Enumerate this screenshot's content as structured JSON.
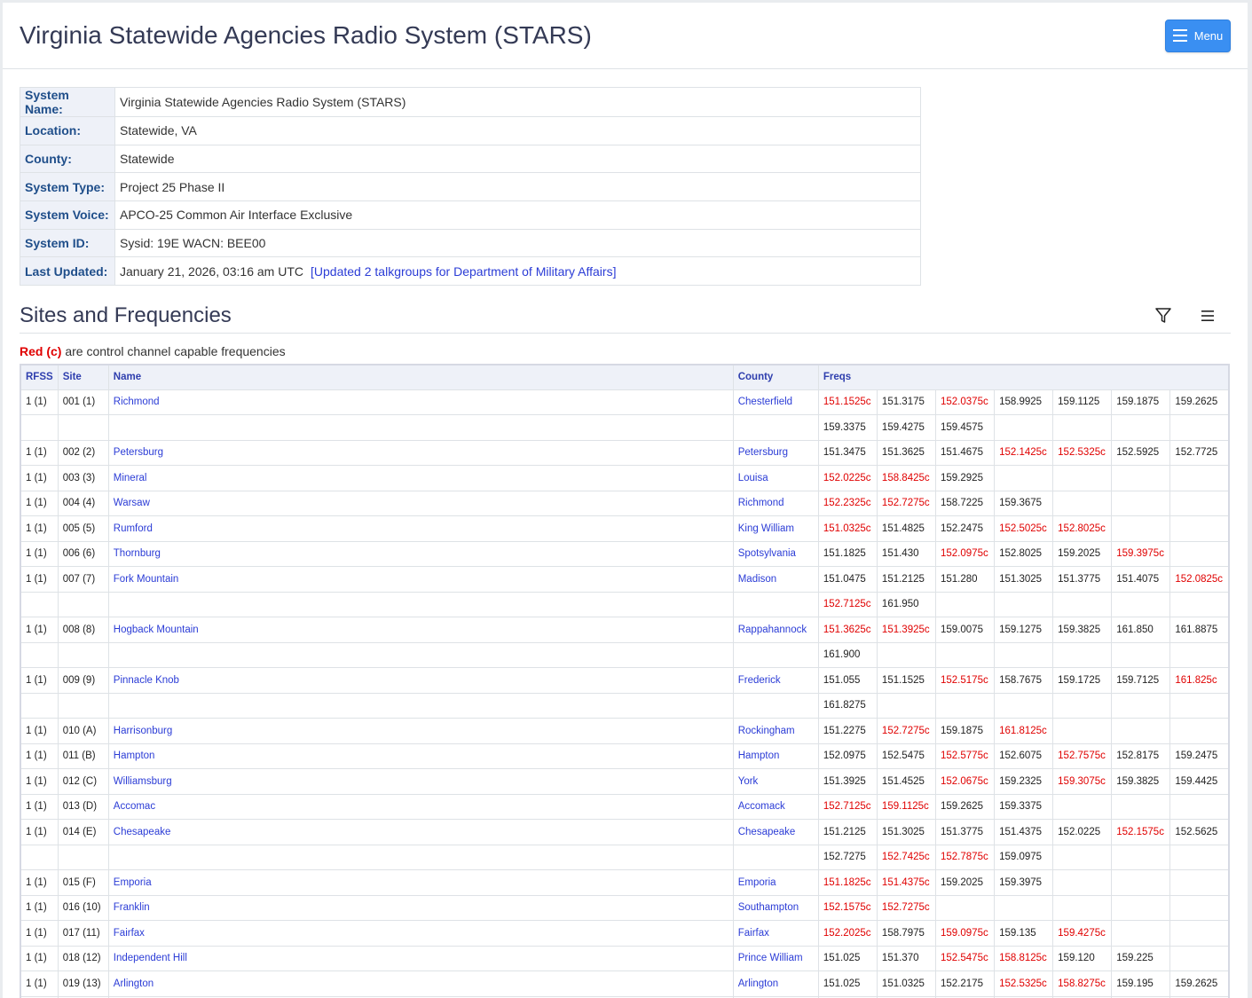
{
  "header": {
    "title": "Virginia Statewide Agencies Radio System (STARS)",
    "menu_label": "Menu"
  },
  "system_info": [
    {
      "label": "System Name:",
      "value": "Virginia Statewide Agencies Radio System (STARS)"
    },
    {
      "label": "Location:",
      "value": "Statewide, VA"
    },
    {
      "label": "County:",
      "value": "Statewide"
    },
    {
      "label": "System Type:",
      "value": "Project 25 Phase II"
    },
    {
      "label": "System Voice:",
      "value": "APCO-25 Common Air Interface Exclusive"
    },
    {
      "label": "System ID:",
      "value": "Sysid: 19E WACN: BEE00"
    },
    {
      "label": "Last Updated:",
      "value": "January 21, 2026, 03:16 am UTC",
      "link": "[Updated 2 talkgroups for Department of Military Affairs]"
    }
  ],
  "sites_section": {
    "title": "Sites and Frequencies",
    "note_red": "Red (c)",
    "note_rest": " are control channel capable frequencies",
    "columns": {
      "rfss": "RFSS",
      "site": "Site",
      "name": "Name",
      "county": "County",
      "freqs": "Freqs"
    },
    "colors": {
      "control": "#e00000",
      "link": "#2b3cd6"
    },
    "rows": [
      {
        "rfss": "1 (1)",
        "site": "001 (1)",
        "name": "Richmond",
        "county": "Chesterfield",
        "freqs": [
          "151.1525c",
          "151.3175",
          "152.0375c",
          "158.9925",
          "159.1125",
          "159.1875",
          "159.2625"
        ]
      },
      {
        "rfss": "",
        "site": "",
        "name": "",
        "county": "",
        "freqs": [
          "159.3375",
          "159.4275",
          "159.4575",
          "",
          "",
          "",
          ""
        ]
      },
      {
        "rfss": "1 (1)",
        "site": "002 (2)",
        "name": "Petersburg",
        "county": "Petersburg",
        "freqs": [
          "151.3475",
          "151.3625",
          "151.4675",
          "152.1425c",
          "152.5325c",
          "152.5925",
          "152.7725"
        ]
      },
      {
        "rfss": "1 (1)",
        "site": "003 (3)",
        "name": "Mineral",
        "county": "Louisa",
        "freqs": [
          "152.0225c",
          "158.8425c",
          "159.2925",
          "",
          "",
          "",
          ""
        ]
      },
      {
        "rfss": "1 (1)",
        "site": "004 (4)",
        "name": "Warsaw",
        "county": "Richmond",
        "freqs": [
          "152.2325c",
          "152.7275c",
          "158.7225",
          "159.3675",
          "",
          "",
          ""
        ]
      },
      {
        "rfss": "1 (1)",
        "site": "005 (5)",
        "name": "Rumford",
        "county": "King William",
        "freqs": [
          "151.0325c",
          "151.4825",
          "152.2475",
          "152.5025c",
          "152.8025c",
          "",
          ""
        ]
      },
      {
        "rfss": "1 (1)",
        "site": "006 (6)",
        "name": "Thornburg",
        "county": "Spotsylvania",
        "freqs": [
          "151.1825",
          "151.430",
          "152.0975c",
          "152.8025",
          "159.2025",
          "159.3975c",
          ""
        ]
      },
      {
        "rfss": "1 (1)",
        "site": "007 (7)",
        "name": "Fork Mountain",
        "county": "Madison",
        "freqs": [
          "151.0475",
          "151.2125",
          "151.280",
          "151.3025",
          "151.3775",
          "151.4075",
          "152.0825c"
        ]
      },
      {
        "rfss": "",
        "site": "",
        "name": "",
        "county": "",
        "freqs": [
          "152.7125c",
          "161.950",
          "",
          "",
          "",
          "",
          ""
        ]
      },
      {
        "rfss": "1 (1)",
        "site": "008 (8)",
        "name": "Hogback Mountain",
        "county": "Rappahannock",
        "freqs": [
          "151.3625c",
          "151.3925c",
          "159.0075",
          "159.1275",
          "159.3825",
          "161.850",
          "161.8875"
        ]
      },
      {
        "rfss": "",
        "site": "",
        "name": "",
        "county": "",
        "freqs": [
          "161.900",
          "",
          "",
          "",
          "",
          "",
          ""
        ]
      },
      {
        "rfss": "1 (1)",
        "site": "009 (9)",
        "name": "Pinnacle Knob",
        "county": "Frederick",
        "freqs": [
          "151.055",
          "151.1525",
          "152.5175c",
          "158.7675",
          "159.1725",
          "159.7125",
          "161.825c"
        ]
      },
      {
        "rfss": "",
        "site": "",
        "name": "",
        "county": "",
        "freqs": [
          "161.8275",
          "",
          "",
          "",
          "",
          "",
          ""
        ]
      },
      {
        "rfss": "1 (1)",
        "site": "010 (A)",
        "name": "Harrisonburg",
        "county": "Rockingham",
        "freqs": [
          "151.2275",
          "152.7275c",
          "159.1875",
          "161.8125c",
          "",
          "",
          ""
        ]
      },
      {
        "rfss": "1 (1)",
        "site": "011 (B)",
        "name": "Hampton",
        "county": "Hampton",
        "freqs": [
          "152.0975",
          "152.5475",
          "152.5775c",
          "152.6075",
          "152.7575c",
          "152.8175",
          "159.2475"
        ]
      },
      {
        "rfss": "1 (1)",
        "site": "012 (C)",
        "name": "Williamsburg",
        "county": "York",
        "freqs": [
          "151.3925",
          "151.4525",
          "152.0675c",
          "159.2325",
          "159.3075c",
          "159.3825",
          "159.4425"
        ]
      },
      {
        "rfss": "1 (1)",
        "site": "013 (D)",
        "name": "Accomac",
        "county": "Accomack",
        "freqs": [
          "152.7125c",
          "159.1125c",
          "159.2625",
          "159.3375",
          "",
          "",
          ""
        ]
      },
      {
        "rfss": "1 (1)",
        "site": "014 (E)",
        "name": "Chesapeake",
        "county": "Chesapeake",
        "freqs": [
          "151.2125",
          "151.3025",
          "151.3775",
          "151.4375",
          "152.0225",
          "152.1575c",
          "152.5625"
        ]
      },
      {
        "rfss": "",
        "site": "",
        "name": "",
        "county": "",
        "freqs": [
          "152.7275",
          "152.7425c",
          "152.7875c",
          "159.0975",
          "",
          "",
          ""
        ]
      },
      {
        "rfss": "1 (1)",
        "site": "015 (F)",
        "name": "Emporia",
        "county": "Emporia",
        "freqs": [
          "151.1825c",
          "151.4375c",
          "159.2025",
          "159.3975",
          "",
          "",
          ""
        ]
      },
      {
        "rfss": "1 (1)",
        "site": "016 (10)",
        "name": "Franklin",
        "county": "Southampton",
        "freqs": [
          "152.1575c",
          "152.7275c",
          "",
          "",
          "",
          "",
          ""
        ]
      },
      {
        "rfss": "1 (1)",
        "site": "017 (11)",
        "name": "Fairfax",
        "county": "Fairfax",
        "freqs": [
          "152.2025c",
          "158.7975",
          "159.0975c",
          "159.135",
          "159.4275c",
          "",
          ""
        ]
      },
      {
        "rfss": "1 (1)",
        "site": "018 (12)",
        "name": "Independent Hill",
        "county": "Prince William",
        "freqs": [
          "151.025",
          "151.370",
          "152.5475c",
          "158.8125c",
          "159.120",
          "159.225",
          ""
        ]
      },
      {
        "rfss": "1 (1)",
        "site": "019 (13)",
        "name": "Arlington",
        "county": "Arlington",
        "freqs": [
          "151.025",
          "151.0325",
          "152.2175",
          "152.5325c",
          "158.8275c",
          "159.195",
          "159.2625"
        ]
      },
      {
        "rfss": "",
        "site": "",
        "name": "",
        "county": "",
        "freqs": [
          "",
          "",
          "",
          "",
          "",
          "",
          ""
        ]
      }
    ]
  }
}
